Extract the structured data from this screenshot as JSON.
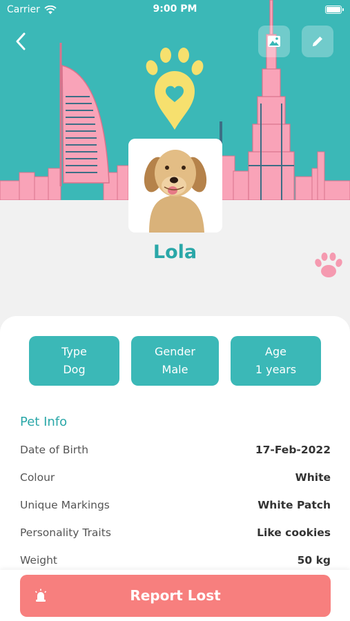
{
  "status_bar": {
    "carrier": "Carrier",
    "time": "9:00 PM"
  },
  "colors": {
    "primary": "#3bb8b7",
    "accent_text": "#2aa7a8",
    "skyline_pink": "#f9a3b8",
    "logo_yellow": "#f6e06e",
    "report": "#f77f7e"
  },
  "header": {
    "back_icon": "chevron-left-icon",
    "gallery_icon": "image-icon",
    "edit_icon": "pencil-icon",
    "logo_icon": "paw-location-pin-icon"
  },
  "pet": {
    "name": "Lola",
    "photo_icon": "golden-retriever-photo"
  },
  "chips": {
    "type": {
      "label": "Type",
      "value": "Dog"
    },
    "gender": {
      "label": "Gender",
      "value": "Male"
    },
    "age": {
      "label": "Age",
      "value": "1 years"
    }
  },
  "pet_info": {
    "title": "Pet Info",
    "rows": [
      {
        "label": "Date of Birth",
        "value": "17-Feb-2022"
      },
      {
        "label": "Colour",
        "value": "White"
      },
      {
        "label": "Unique Markings",
        "value": "White Patch"
      },
      {
        "label": "Personality Traits",
        "value": "Like cookies"
      },
      {
        "label": "Weight",
        "value": "50 kg"
      }
    ]
  },
  "report_button": {
    "label": "Report Lost",
    "icon": "siren-icon"
  }
}
